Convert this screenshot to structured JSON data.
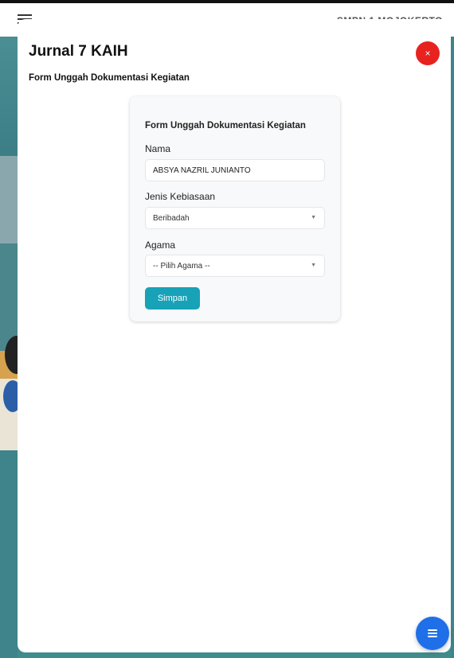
{
  "background": {
    "school_name": "SMPN 1 MOJOKERTO"
  },
  "modal": {
    "title": "Jurnal 7 KAIH",
    "close_glyph": "×",
    "subtitle": "Form Unggah Dokumentasi Kegiatan"
  },
  "form": {
    "title": "Form Unggah Dokumentasi Kegiatan",
    "nama": {
      "label": "Nama",
      "value": "ABSYA NAZRIL JUNIANTO"
    },
    "jenis_kebiasaan": {
      "label": "Jenis Kebiasaan",
      "selected": "Beribadah"
    },
    "agama": {
      "label": "Agama",
      "selected": "-- Pilih Agama --"
    },
    "submit_label": "Simpan"
  },
  "colors": {
    "close_button": "#e8221f",
    "primary_button": "#17a2b8",
    "fab": "#1e6fe8"
  },
  "icons": {
    "close": "close-icon",
    "caret": "chevron-down-icon",
    "menu": "menu-icon"
  }
}
